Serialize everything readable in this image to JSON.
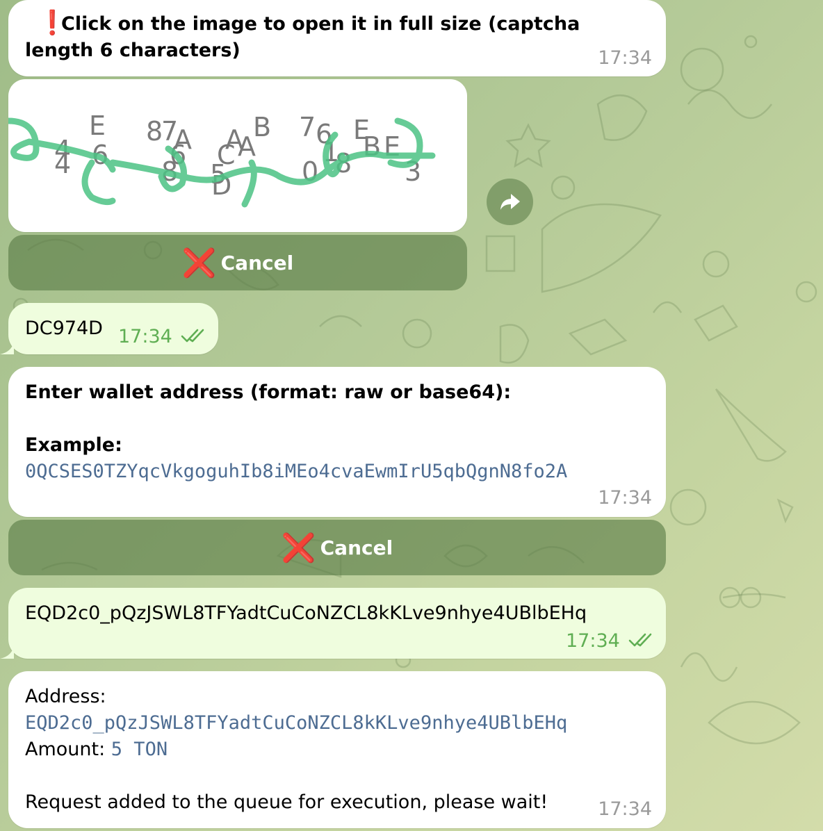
{
  "msg1": {
    "icon": "exclamation-icon",
    "text": "Click on the image to open it in full size (captcha length 6 characters)",
    "time": "17:34"
  },
  "captcha": {
    "chars": [
      "E",
      "6",
      "4",
      "4",
      "8",
      "7",
      "A",
      "6",
      "8",
      "A",
      "C",
      "A",
      "B",
      "5",
      "D",
      "7",
      "6",
      "E",
      "0",
      "B",
      "E",
      "8",
      "1",
      "3"
    ]
  },
  "buttons": {
    "cancel_label": "Cancel",
    "cancel_icon": "cross-mark-icon"
  },
  "msg2": {
    "text": "DC974D",
    "time": "17:34"
  },
  "msg3": {
    "line1": "Enter wallet address (format: raw or base64):",
    "example_label": "Example:",
    "example_value": "0QCSES0TZYqcVkgoguhIb8iMEo4cvaEwmIrU5qbQgnN8fo2A",
    "time": "17:34"
  },
  "msg4": {
    "text": "EQD2c0_pQzJSWL8TFYadtCuCoNZCL8kKLve9nhye4UBlbEHq",
    "time": "17:34"
  },
  "msg5": {
    "address_label": "Address:",
    "address_value": "EQD2c0_pQzJSWL8TFYadtCuCoNZCL8kKLve9nhye4UBlbEHq",
    "amount_label": "Amount:",
    "amount_value": "5 TON",
    "status": "Request added to the queue for execution, please wait!",
    "time": "17:34"
  },
  "colors": {
    "accent_green": "#5fae53",
    "mono_blue": "#4d6c92",
    "button_bg": "#6f8f5c"
  }
}
